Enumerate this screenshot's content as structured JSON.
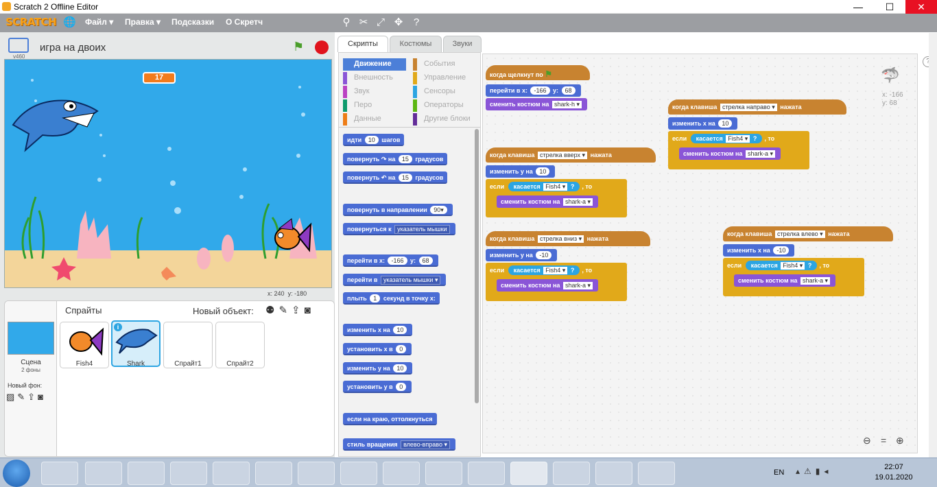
{
  "window": {
    "title": "Scratch 2 Offline Editor",
    "min": "—",
    "max": "☐",
    "close": "✕"
  },
  "menubar": {
    "logo": "SCRATCH",
    "items": [
      "Файл ▾",
      "Правка ▾",
      "Подсказки",
      "О Скретч"
    ]
  },
  "stage": {
    "title": "игра на двоих",
    "version": "v460",
    "score": "17",
    "x_label": "x:",
    "x_val": "240",
    "y_label": "y:",
    "y_val": "-180"
  },
  "sprites": {
    "header": "Спрайты",
    "new_object": "Новый объект:",
    "scene_label": "Сцена",
    "scene_sub": "2 фоны",
    "new_bg": "Новый фон:",
    "items": [
      "Fish4",
      "Shark",
      "Спрайт1",
      "Спрайт2"
    ]
  },
  "tabs": [
    "Скрипты",
    "Костюмы",
    "Звуки"
  ],
  "categories": {
    "left": [
      "Движение",
      "Внешность",
      "Звук",
      "Перо",
      "Данные"
    ],
    "right": [
      "События",
      "Управление",
      "Сенсоры",
      "Операторы",
      "Другие блоки"
    ]
  },
  "palette": {
    "b1": "идти",
    "b1n": "10",
    "b1s": "шагов",
    "b2": "повернуть ↷ на",
    "b2n": "15",
    "b2s": "градусов",
    "b3": "повернуть ↶ на",
    "b3n": "15",
    "b3s": "градусов",
    "b4": "повернуть в направлении",
    "b4n": "90▾",
    "b5": "повернуться к",
    "b5d": "указатель мышки",
    "b6": "перейти в x:",
    "b6x": "-166",
    "b6y": "y:",
    "b6yn": "68",
    "b7": "перейти в",
    "b7d": "указатель мышки ▾",
    "b8": "плыть",
    "b8n": "1",
    "b8s": "секунд в точку x:",
    "b9": "изменить х на",
    "b9n": "10",
    "b10": "установить х в",
    "b10n": "0",
    "b11": "изменить у на",
    "b11n": "10",
    "b12": "установить у в",
    "b12n": "0",
    "b13": "если на краю, оттолкнуться",
    "b14": "стиль вращения",
    "b14d": "влево-вправо ▾"
  },
  "scripts": {
    "s1": {
      "hat": "когда щелкнут по",
      "go": "перейти в x:",
      "x": "-166",
      "y_l": "y:",
      "y": "68",
      "look": "сменить костюм на",
      "costume": "shark-h ▾"
    },
    "s2": {
      "hat": "когда клавиша",
      "key": "стрелка вверх ▾",
      "tail": "нажата",
      "chg": "изменить у на",
      "n": "10",
      "if": "если",
      "touch": "касается",
      "obj": "Fish4 ▾",
      "q": "?",
      "then": ", то",
      "look": "сменить костюм на",
      "costume": "shark-a ▾"
    },
    "s3": {
      "hat": "когда клавиша",
      "key": "стрелка вниз ▾",
      "tail": "нажата",
      "chg": "изменить у на",
      "n": "-10",
      "if": "если",
      "touch": "касается",
      "obj": "Fish4 ▾",
      "q": "?",
      "then": ", то",
      "look": "сменить костюм на",
      "costume": "shark-a ▾"
    },
    "s4": {
      "hat": "когда клавиша",
      "key": "стрелка направо ▾",
      "tail": "нажата",
      "chg": "изменить х на",
      "n": "10",
      "if": "если",
      "touch": "касается",
      "obj": "Fish4 ▾",
      "q": "?",
      "then": ", то",
      "look": "сменить костюм на",
      "costume": "shark-a ▾"
    },
    "s5": {
      "hat": "когда клавиша",
      "key": "стрелка влево ▾",
      "tail": "нажата",
      "chg": "изменить х на",
      "n": "-10",
      "if": "если",
      "touch": "касается",
      "obj": "Fish4 ▾",
      "q": "?",
      "then": ", то",
      "look": "сменить костюм на",
      "costume": "shark-a ▾"
    },
    "sprite_x": "x: -166",
    "sprite_y": "y: 68"
  },
  "taskbar": {
    "lang": "EN",
    "time": "22:07",
    "date": "19.01.2020"
  },
  "colors": {
    "motion": "#4a6cd4",
    "looks": "#8a55d7",
    "events": "#c88330",
    "control": "#e1a91a",
    "sensing": "#2ca5e2"
  }
}
